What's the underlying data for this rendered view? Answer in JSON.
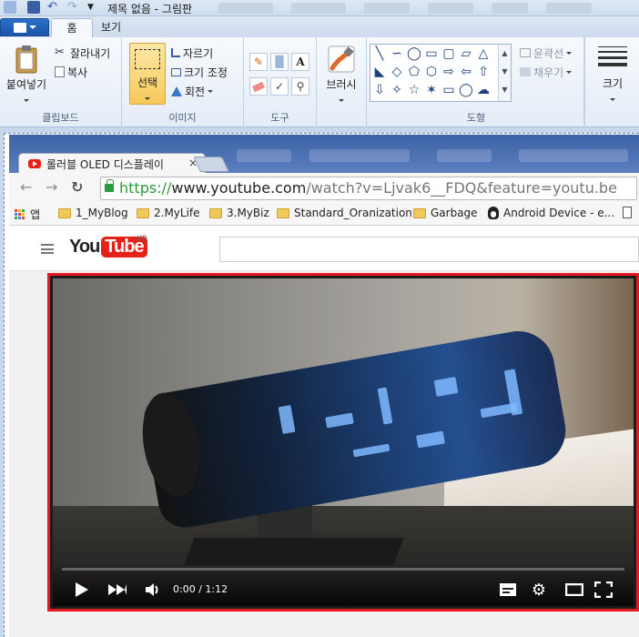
{
  "paint": {
    "window_title": "제목 없음 - 그림판",
    "tabs": {
      "home": "홈",
      "view": "보기"
    },
    "clipboard": {
      "paste": "붙여넣기",
      "cut": "잘라내기",
      "copy": "복사",
      "label": "클립보드"
    },
    "image": {
      "select": "선택",
      "crop": "자르기",
      "resize": "크기 조정",
      "rotate": "회전",
      "label": "이미지"
    },
    "tools": {
      "label": "도구"
    },
    "brush": {
      "label": "브러시"
    },
    "shapes": {
      "outline": "윤곽선",
      "fill": "채우기",
      "label": "도형"
    },
    "size": {
      "label": "크기"
    }
  },
  "browser": {
    "tab_title": "롤러블 OLED 디스플레이",
    "tab_close": "×",
    "url": {
      "proto": "https://",
      "host": "www.youtube.com",
      "path": "/watch?v=Ljvak6__FDQ&feature=youtu.be"
    },
    "bookmarks": [
      {
        "label": "앱",
        "icon": "apps-icon"
      },
      {
        "label": "1_MyBlog",
        "icon": "folder-icon"
      },
      {
        "label": "2.MyLife",
        "icon": "folder-icon"
      },
      {
        "label": "3.MyBiz",
        "icon": "folder-icon"
      },
      {
        "label": "Standard_Oranization",
        "icon": "folder-icon"
      },
      {
        "label": "Garbage",
        "icon": "folder-icon"
      },
      {
        "label": "Android Device - e...",
        "icon": "penguin-icon"
      }
    ]
  },
  "youtube": {
    "logo_you": "You",
    "logo_tube": "Tube",
    "region": "KR",
    "player": {
      "time": "0:00 / 1:12",
      "progress_fraction": 0.0,
      "highlight_color": "#e61923"
    }
  },
  "colors": {
    "brand_red": "#e62117",
    "paint_blue": "#1b55a8"
  }
}
